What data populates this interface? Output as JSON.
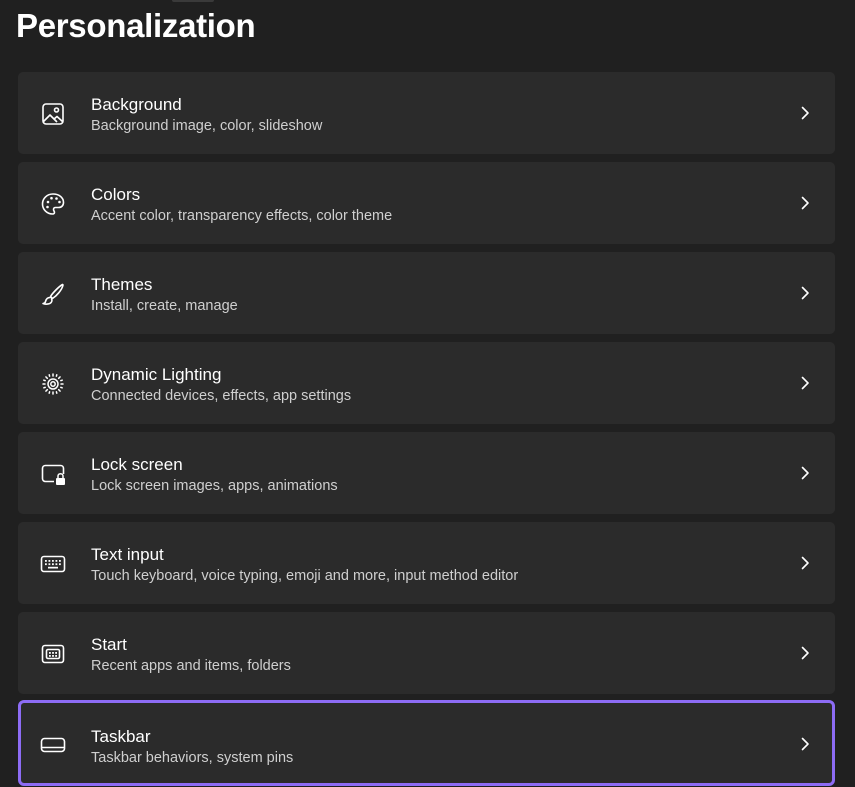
{
  "page": {
    "title": "Personalization"
  },
  "items": [
    {
      "title": "Background",
      "subtitle": "Background image, color, slideshow",
      "icon": "image-icon"
    },
    {
      "title": "Colors",
      "subtitle": "Accent color, transparency effects, color theme",
      "icon": "palette-icon"
    },
    {
      "title": "Themes",
      "subtitle": "Install, create, manage",
      "icon": "brush-icon"
    },
    {
      "title": "Dynamic Lighting",
      "subtitle": "Connected devices, effects, app settings",
      "icon": "lighting-icon"
    },
    {
      "title": "Lock screen",
      "subtitle": "Lock screen images, apps, animations",
      "icon": "lock-screen-icon"
    },
    {
      "title": "Text input",
      "subtitle": "Touch keyboard, voice typing, emoji and more, input method editor",
      "icon": "keyboard-icon"
    },
    {
      "title": "Start",
      "subtitle": "Recent apps and items, folders",
      "icon": "start-icon"
    },
    {
      "title": "Taskbar",
      "subtitle": "Taskbar behaviors, system pins",
      "icon": "taskbar-icon"
    }
  ],
  "colors": {
    "background": "#202020",
    "card": "#2b2b2b",
    "selection_border": "#8d6cf5",
    "text_primary": "#ffffff",
    "text_secondary": "#cfcfcf"
  }
}
